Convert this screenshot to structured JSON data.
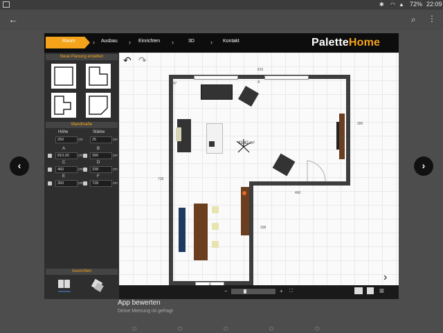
{
  "status": {
    "time": "22:09",
    "battery": "72%"
  },
  "nav": {
    "items": [
      "Raum",
      "Ausbau",
      "Einrichten",
      "3D",
      "Kontakt"
    ],
    "brand_a": "Palette",
    "brand_b": "Home"
  },
  "sidebar": {
    "planning_header": "Neue Planung erstellen",
    "wall_header": "Wandmaße",
    "height_label": "Höhe",
    "height_value": "250",
    "height_unit": "cm",
    "thickness_label": "Stärke",
    "thickness_value": "25",
    "thickness_unit": "cm",
    "walls": [
      {
        "name": "A",
        "value": "810,00"
      },
      {
        "name": "B",
        "value": "390"
      },
      {
        "name": "C",
        "value": "460"
      },
      {
        "name": "D",
        "value": "338"
      },
      {
        "name": "E",
        "value": "350"
      },
      {
        "name": "F",
        "value": "728"
      }
    ],
    "align_header": "Ausrichten"
  },
  "plan": {
    "dim_top": "810",
    "dim_right": "390",
    "dim_left": "728",
    "dim_mid": "460",
    "dim_inner": "338",
    "dim_bottom": "350",
    "area": "43,42 m²",
    "labels": {
      "A": "A",
      "B": "B",
      "C": "C",
      "D": "D",
      "E": "E",
      "F": "F"
    },
    "angle": "90°"
  },
  "bottom": {
    "minus": "−",
    "plus": "+"
  },
  "below": {
    "title": "App bewerten",
    "subtitle": "Deine Meinung ist gefragt"
  }
}
